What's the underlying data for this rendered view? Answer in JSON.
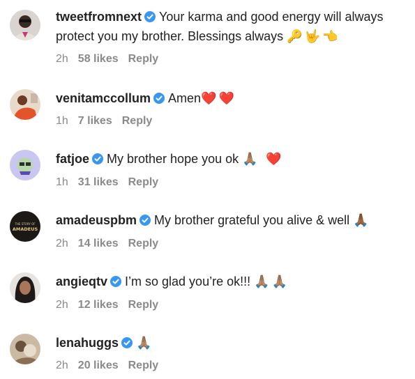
{
  "comments": [
    {
      "username": "tweetfromnext",
      "text": "Your karma and good energy will always protect you my brother. Blessings always",
      "emoji": "🔑🤟👈",
      "time": "2h",
      "likes": "58 likes",
      "reply": "Reply"
    },
    {
      "username": "venitamccollum",
      "text": "Amen",
      "emoji": "❤️❤️",
      "time": "1h",
      "likes": "7 likes",
      "reply": "Reply"
    },
    {
      "username": "fatjoe",
      "text": "My brother hope you ok",
      "emoji": "🙏🏽 ❤️",
      "time": "1h",
      "likes": "31 likes",
      "reply": "Reply"
    },
    {
      "username": "amadeuspbm",
      "text": "My brother grateful you alive & well",
      "emoji": "🙏🏾",
      "time": "2h",
      "likes": "14 likes",
      "reply": "Reply"
    },
    {
      "username": "angieqtv",
      "text": "I’m so glad you’re ok!!!",
      "emoji": "🙏🏽🙏🏽",
      "time": "2h",
      "likes": "12 likes",
      "reply": "Reply"
    },
    {
      "username": "lenahuggs",
      "text": "",
      "emoji": "🙏🏽",
      "time": "2h",
      "likes": "20 likes",
      "reply": "Reply"
    }
  ],
  "icons": {
    "verified": "verified-badge-icon"
  },
  "colors": {
    "verified_blue": "#3897f0",
    "meta_gray": "#8a8a8a",
    "text": "#222222"
  },
  "avatar_labels": {
    "amadeuspbm": "AMADEUS"
  }
}
